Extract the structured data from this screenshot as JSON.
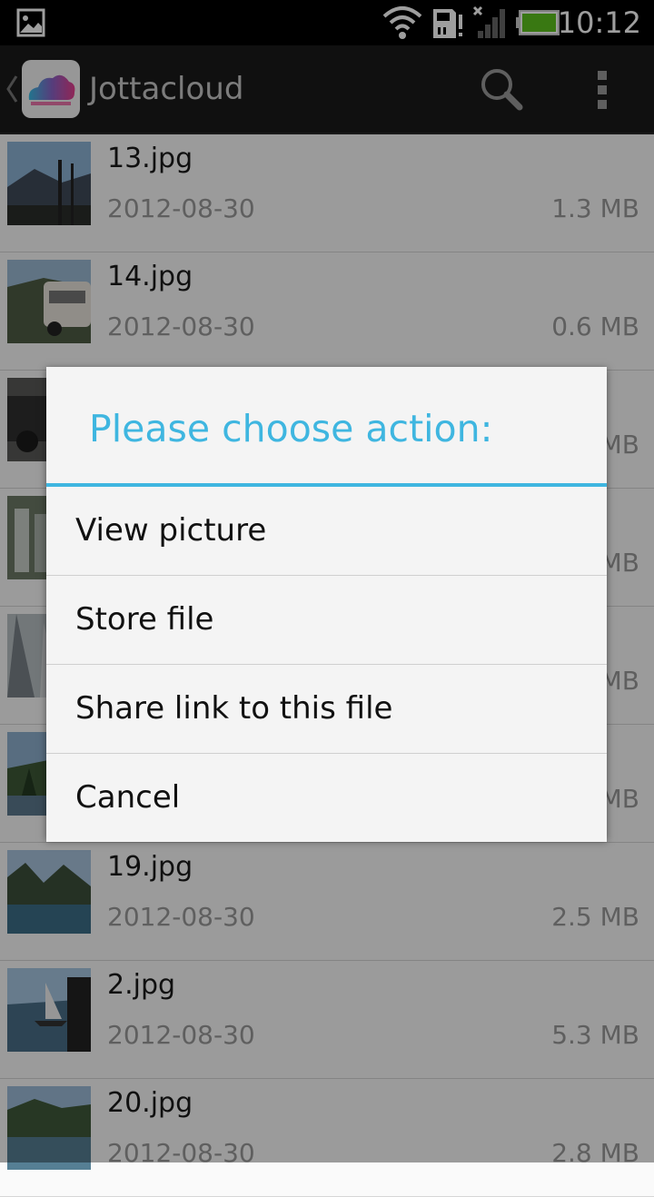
{
  "status_bar": {
    "time": "10:12",
    "icons": [
      "gallery-notification-icon",
      "wifi-icon",
      "sd-card-icon",
      "no-signal-icon",
      "battery-icon"
    ],
    "battery_color": "#5dc21e"
  },
  "action_bar": {
    "title": "Jottacloud",
    "icons": [
      "back-chevron-icon",
      "jottacloud-logo",
      "search-icon",
      "overflow-menu-icon"
    ]
  },
  "files": [
    {
      "name": "13.jpg",
      "date": "2012-08-30",
      "size": "1.3 MB"
    },
    {
      "name": "14.jpg",
      "date": "2012-08-30",
      "size": "0.6 MB"
    },
    {
      "name": "",
      "date": "",
      "size": "MB"
    },
    {
      "name": "",
      "date": "",
      "size": "MB"
    },
    {
      "name": "",
      "date": "",
      "size": "MB"
    },
    {
      "name": "",
      "date": "",
      "size": "MB"
    },
    {
      "name": "19.jpg",
      "date": "2012-08-30",
      "size": "2.5 MB"
    },
    {
      "name": "2.jpg",
      "date": "2012-08-30",
      "size": "5.3 MB"
    },
    {
      "name": "20.jpg",
      "date": "2012-08-30",
      "size": "2.8 MB"
    }
  ],
  "dialog": {
    "title": "Please choose action:",
    "accent_color": "#3fb6e0",
    "options": [
      "View picture",
      "Store file",
      "Share link to this file",
      "Cancel"
    ]
  }
}
